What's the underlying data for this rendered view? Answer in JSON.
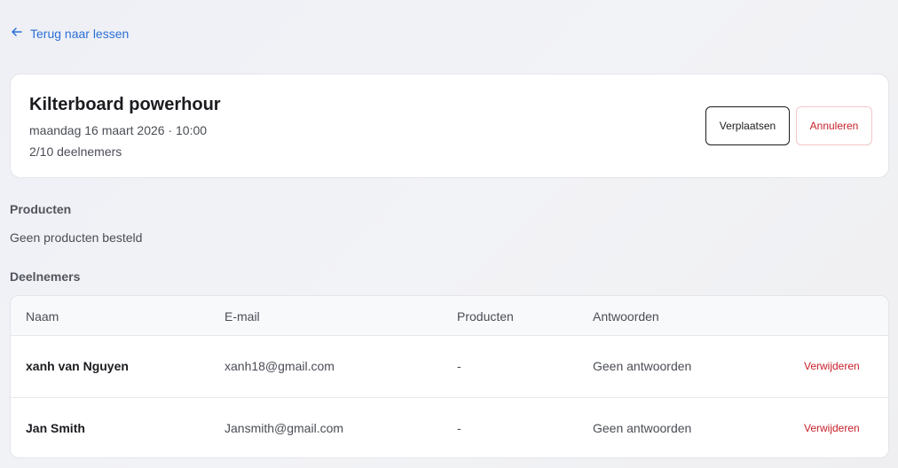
{
  "back_link": {
    "label": "Terug naar lessen"
  },
  "lesson": {
    "title": "Kilterboard powerhour",
    "datetime": "maandag 16 maart 2026 · 10:00",
    "participants": "2/10 deelnemers",
    "reschedule_label": "Verplaatsen",
    "cancel_label": "Annuleren"
  },
  "products": {
    "heading": "Producten",
    "empty_text": "Geen producten besteld"
  },
  "participants": {
    "heading": "Deelnemers",
    "columns": [
      "Naam",
      "E-mail",
      "Producten",
      "Antwoorden"
    ],
    "rows": [
      {
        "name": "xanh van Nguyen",
        "email": "xanh18@gmail.com",
        "products": "-",
        "answers": "Geen antwoorden",
        "action": "Verwijderen"
      },
      {
        "name": "Jan Smith",
        "email": "Jansmith@gmail.com",
        "products": "-",
        "answers": "Geen antwoorden",
        "action": "Verwijderen"
      }
    ]
  },
  "colors": {
    "link": "#2c6fd6",
    "danger": "#c81f2a"
  },
  "icons": {
    "back": "arrow-left-icon"
  }
}
